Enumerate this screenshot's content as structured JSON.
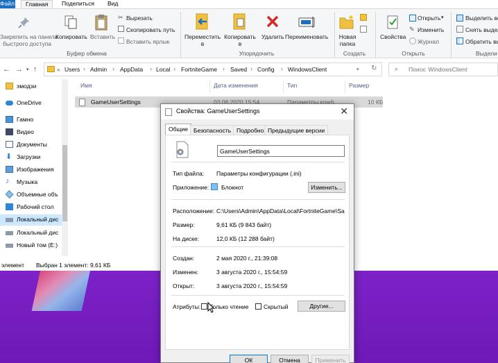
{
  "menu": {
    "file": "Файл",
    "home": "Главная",
    "share": "Поделиться",
    "view": "Вид"
  },
  "ribbon": {
    "pin": "Закрепить на панели\nбыстрого доступа",
    "pin_line1": "Закрепить на панели",
    "pin_line2": "быстрого доступа",
    "copy": "Копировать",
    "paste": "Вставить",
    "cut": "Вырезать",
    "copy_path": "Скопировать путь",
    "paste_shortcut": "Вставить ярлык",
    "clipboard_group": "Буфер обмена",
    "move_to": "Переместить",
    "move_to_2": "в",
    "copy_to": "Копировать",
    "copy_to_2": "в",
    "delete": "Удалить",
    "rename": "Переименовать",
    "organize_group": "Упорядочить",
    "new_folder": "Новая",
    "new_folder_2": "папка",
    "create_group": "Создать",
    "properties": "Свойства",
    "open": "Открыть",
    "edit": "Изменить",
    "history": "Журнал",
    "open_group": "Открыть",
    "select_all": "Выделить все",
    "select_none": "Снять выдел",
    "invert_selection": "Обратить выд",
    "select_group": "Выдели"
  },
  "address": {
    "crumbs": [
      "Users",
      "Admin",
      "AppData",
      "Local",
      "FortniteGame",
      "Saved",
      "Config",
      "WindowsClient"
    ],
    "lead": "«",
    "search_placeholder": "Поиск: WindowsClient"
  },
  "nav": {
    "items": [
      {
        "label": "эмодзи",
        "icon": "folder-icon"
      },
      {
        "label": "OneDrive",
        "icon": "cloud-icon"
      },
      {
        "label": "Гамно",
        "icon": "pc-icon"
      },
      {
        "label": "Видео",
        "icon": "video-icon"
      },
      {
        "label": "Документы",
        "icon": "document-icon"
      },
      {
        "label": "Загрузки",
        "icon": "download-icon"
      },
      {
        "label": "Изображения",
        "icon": "image-icon"
      },
      {
        "label": "Музыка",
        "icon": "music-icon"
      },
      {
        "label": "Объемные объ",
        "icon": "cube-icon"
      },
      {
        "label": "Рабочий стол",
        "icon": "desktop-icon"
      },
      {
        "label": "Локальный дис",
        "icon": "drive-icon"
      },
      {
        "label": "Локальный дис",
        "icon": "drive-icon"
      },
      {
        "label": "Новый том (E:)",
        "icon": "drive-icon"
      }
    ]
  },
  "columns": {
    "name": "Имя",
    "date": "Дата изменения",
    "type": "Тип",
    "size": "Размер"
  },
  "file": {
    "name": "GameUserSettings",
    "date": "03.08.2020 15:54",
    "type": "Параметры конф...",
    "size": "10 КБ"
  },
  "status": {
    "count": "элемент",
    "selected": "Выбран 1 элемент: 9,61 КБ"
  },
  "dialog": {
    "title": "Свойства: GameUserSettings",
    "tabs": [
      "Общие",
      "Безопасность",
      "Подробно",
      "Предыдущие версии"
    ],
    "name_value": "GameUserSettings",
    "file_type_label": "Тип файла:",
    "file_type_value": "Параметры конфигурации (.ini)",
    "app_label": "Приложение:",
    "app_value": "Блокнот",
    "change_button": "Изменить...",
    "location_label": "Расположение:",
    "location_value": "C:\\Users\\Admin\\AppData\\Local\\FortniteGame\\Saved",
    "size_label": "Размер:",
    "size_value": "9,61 КБ (9 843 байт)",
    "disk_label": "На диске:",
    "disk_value": "12,0 КБ (12 288 байт)",
    "created_label": "Создан:",
    "created_value": "2 мая 2020 г., 21:39:08",
    "modified_label": "Изменен:",
    "modified_value": "3 августа 2020 г., 15:54:59",
    "accessed_label": "Открыт:",
    "accessed_value": "3 августа 2020 г., 15:54:59",
    "attributes_label": "Атрибуты:",
    "readonly_label": "Только чтение",
    "hidden_label": "Скрытый",
    "other_button": "Другие...",
    "ok": "ОК",
    "cancel": "Отмена",
    "apply": "Применить"
  },
  "colors": {
    "accent": "#1a6fc2",
    "desktop": "#7a1fc6",
    "selection": "#cce8ff",
    "delete_red": "#d62828"
  }
}
